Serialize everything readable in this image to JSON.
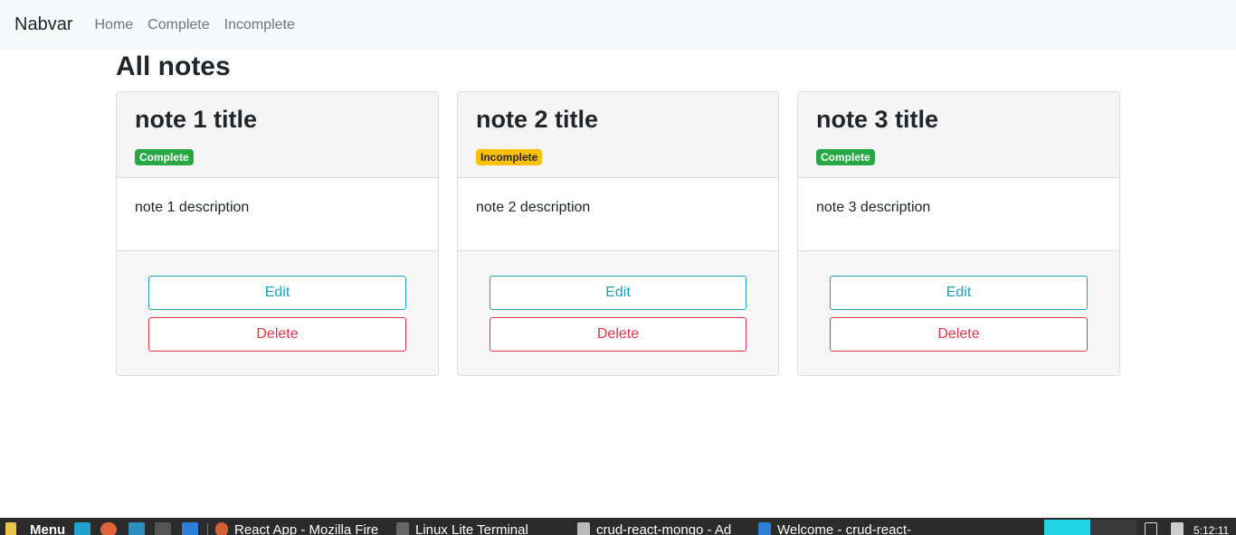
{
  "navbar": {
    "brand": "Nabvar",
    "links": [
      "Home",
      "Complete",
      "Incomplete"
    ]
  },
  "page": {
    "title": "All notes"
  },
  "notes": [
    {
      "title": "note 1 title",
      "status": "Complete",
      "description": "note 1 description",
      "edit_label": "Edit",
      "delete_label": "Delete"
    },
    {
      "title": "note 2 title",
      "status": "Incomplete",
      "description": "note 2 description",
      "edit_label": "Edit",
      "delete_label": "Delete"
    },
    {
      "title": "note 3 title",
      "status": "Complete",
      "description": "note 3 description",
      "edit_label": "Edit",
      "delete_label": "Delete"
    }
  ],
  "colors": {
    "complete": "#28a745",
    "incomplete": "#ffc107",
    "edit": "#17a2b8",
    "delete": "#dc3545"
  },
  "taskbar": {
    "menu_label": "Menu",
    "windows": [
      {
        "label": "React App - Mozilla Fire",
        "icon": "firefox-icon"
      },
      {
        "label": "Linux Lite Terminal",
        "icon": "terminal-icon"
      },
      {
        "label": "crud-react-mongo - Ad",
        "icon": "folder-icon"
      },
      {
        "label": "Welcome - crud-react-",
        "icon": "vscode-icon"
      }
    ],
    "clock": "5:12:11"
  }
}
